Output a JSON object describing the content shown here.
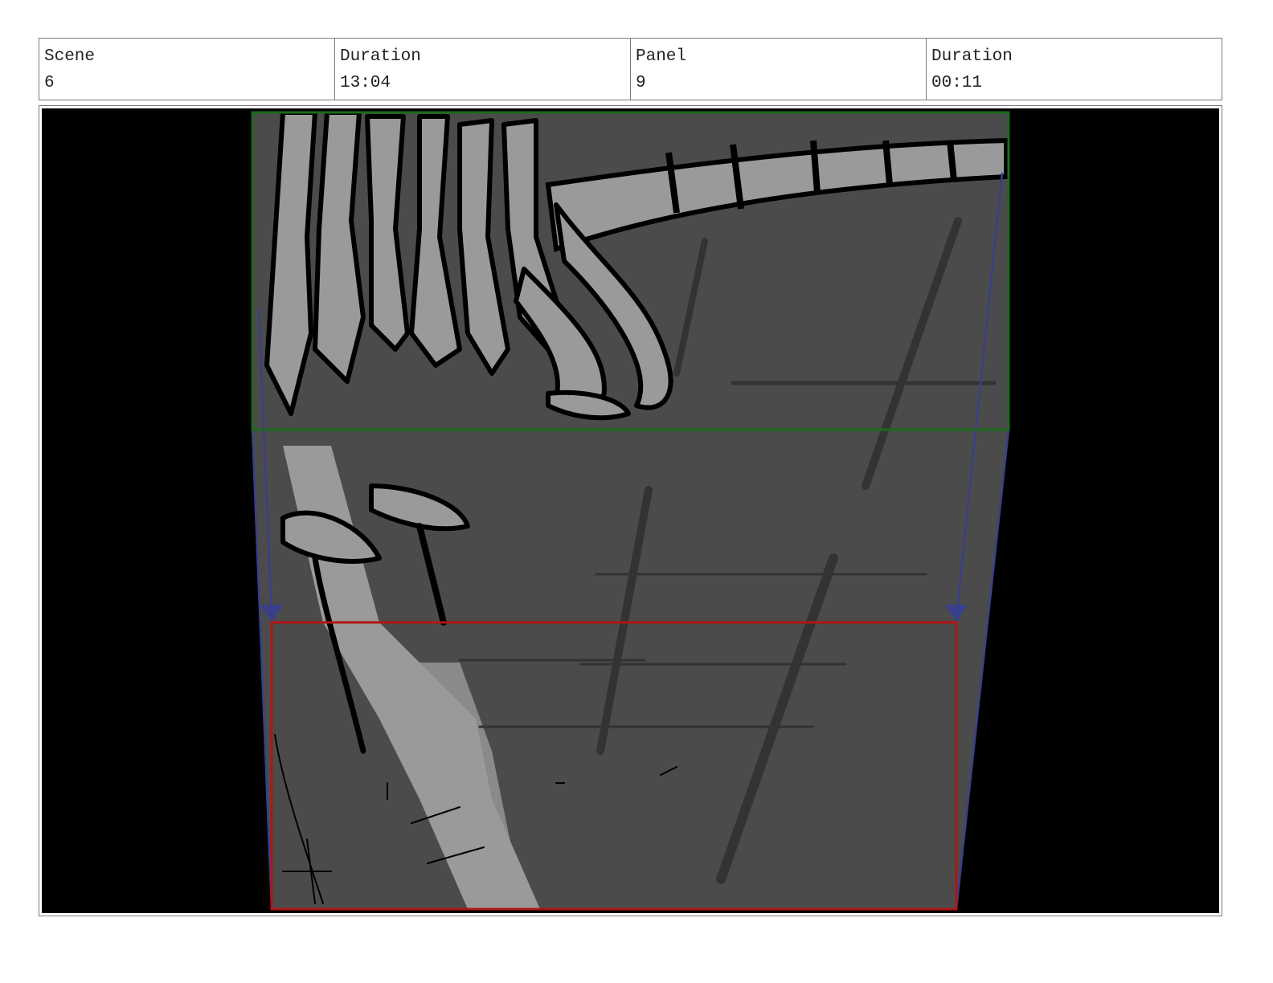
{
  "header": {
    "scene": {
      "label": "Scene",
      "value": "6"
    },
    "scene_duration": {
      "label": "Duration",
      "value": "13:04"
    },
    "panel": {
      "label": "Panel",
      "value": "9"
    },
    "panel_duration": {
      "label": "Duration",
      "value": "00:11"
    }
  },
  "colors": {
    "background": "#000000",
    "sketch_fill": "#4b4b4b",
    "light_gray": "#9a9a9a",
    "ink": "#000000",
    "start_frame": "#1a6b1a",
    "end_frame": "#b01515",
    "camera_path": "#3a3f8a"
  }
}
